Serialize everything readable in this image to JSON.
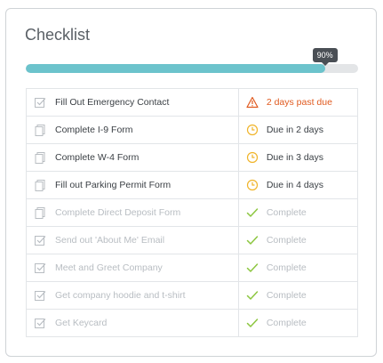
{
  "checklist": {
    "title": "Checklist",
    "progress": {
      "percent": 90,
      "label": "90%"
    },
    "colors": {
      "accent": "#6cc3cc",
      "overdue": "#e05a1f",
      "due": "#f0b429",
      "complete": "#8cc63f",
      "muted": "#b8bdc2"
    },
    "tasks": [
      {
        "label": "Fill Out Emergency Contact",
        "task_icon": "checkbox-icon",
        "status": "overdue",
        "status_icon": "warning-icon",
        "status_text": "2 days past due"
      },
      {
        "label": "Complete I-9 Form",
        "task_icon": "document-icon",
        "status": "due",
        "status_icon": "clock-icon",
        "status_text": "Due in 2 days"
      },
      {
        "label": "Complete W-4 Form",
        "task_icon": "document-icon",
        "status": "due",
        "status_icon": "clock-icon",
        "status_text": "Due in 3 days"
      },
      {
        "label": "Fill out Parking Permit Form",
        "task_icon": "document-icon",
        "status": "due",
        "status_icon": "clock-icon",
        "status_text": "Due in 4 days"
      },
      {
        "label": "Complete Direct Deposit Form",
        "task_icon": "document-icon",
        "status": "complete",
        "status_icon": "check-icon",
        "status_text": "Complete"
      },
      {
        "label": "Send out 'About Me' Email",
        "task_icon": "checkbox-icon",
        "status": "complete",
        "status_icon": "check-icon",
        "status_text": "Complete"
      },
      {
        "label": "Meet and Greet Company",
        "task_icon": "checkbox-icon",
        "status": "complete",
        "status_icon": "check-icon",
        "status_text": "Complete"
      },
      {
        "label": "Get company hoodie and t-shirt",
        "task_icon": "checkbox-icon",
        "status": "complete",
        "status_icon": "check-icon",
        "status_text": "Complete"
      },
      {
        "label": "Get Keycard",
        "task_icon": "checkbox-icon",
        "status": "complete",
        "status_icon": "check-icon",
        "status_text": "Complete"
      }
    ]
  }
}
